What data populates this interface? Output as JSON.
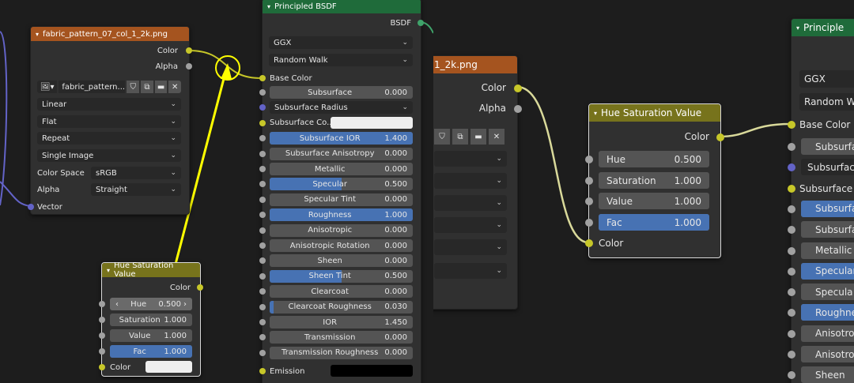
{
  "colors": {
    "wire_yellow": "#c7c729",
    "annotation": "#ffff00",
    "orange_header": "#a5541f",
    "green_header": "#1f6b3a",
    "olive_header": "#77731c",
    "field_fill": "#4772b3"
  },
  "left": {
    "image_node": {
      "title": "fabric_pattern_07_col_1_2k.png",
      "outputs": [
        "Color",
        "Alpha"
      ],
      "image_name": "fabric_pattern...",
      "interpolation": "Linear",
      "projection": "Flat",
      "extension": "Repeat",
      "source": "Single Image",
      "color_space_label": "Color Space",
      "color_space": "sRGB",
      "alpha_label": "Alpha",
      "alpha_mode": "Straight",
      "vector_label": "Vector"
    },
    "hsv_node": {
      "title": "Hue Saturation Value",
      "output": "Color",
      "fields": [
        {
          "label": "Hue",
          "value": "0.500"
        },
        {
          "label": "Saturation",
          "value": "1.000"
        },
        {
          "label": "Value",
          "value": "1.000"
        },
        {
          "label": "Fac",
          "value": "1.000",
          "fill": 1.0
        }
      ],
      "color_label": "Color"
    },
    "bsdf_node": {
      "title": "Principled BSDF",
      "output": "BSDF",
      "distribution": "GGX",
      "subsurface_method": "Random Walk",
      "base_color_label": "Base Color",
      "rows": [
        {
          "label": "Subsurface",
          "value": "0.000",
          "fill": 0
        },
        {
          "label": "Subsurface Radius",
          "value": "",
          "type": "drop"
        },
        {
          "label": "Subsurface Co...",
          "value": "",
          "type": "color"
        },
        {
          "label": "Subsurface IOR",
          "value": "1.400",
          "fill": 1.0
        },
        {
          "label": "Subsurface Anisotropy",
          "value": "0.000",
          "fill": 0
        },
        {
          "label": "Metallic",
          "value": "0.000",
          "fill": 0
        },
        {
          "label": "Specular",
          "value": "0.500",
          "fill": 0.5
        },
        {
          "label": "Specular Tint",
          "value": "0.000",
          "fill": 0
        },
        {
          "label": "Roughness",
          "value": "1.000",
          "fill": 1.0
        },
        {
          "label": "Anisotropic",
          "value": "0.000",
          "fill": 0
        },
        {
          "label": "Anisotropic Rotation",
          "value": "0.000",
          "fill": 0
        },
        {
          "label": "Sheen",
          "value": "0.000",
          "fill": 0
        },
        {
          "label": "Sheen Tint",
          "value": "0.500",
          "fill": 0.5
        },
        {
          "label": "Clearcoat",
          "value": "0.000",
          "fill": 0
        },
        {
          "label": "Clearcoat Roughness",
          "value": "0.030",
          "fill": 0.03
        },
        {
          "label": "IOR",
          "value": "1.450",
          "fill": 0
        },
        {
          "label": "Transmission",
          "value": "0.000",
          "fill": 0
        },
        {
          "label": "Transmission Roughness",
          "value": "0.000",
          "fill": 0
        }
      ],
      "emission_label": "Emission"
    }
  },
  "right": {
    "image_node": {
      "title": "1_2k.png",
      "outputs": [
        "Color",
        "Alpha"
      ]
    },
    "hsv_node": {
      "title": "Hue Saturation Value",
      "output": "Color",
      "fields": [
        {
          "label": "Hue",
          "value": "0.500"
        },
        {
          "label": "Saturation",
          "value": "1.000"
        },
        {
          "label": "Value",
          "value": "1.000"
        },
        {
          "label": "Fac",
          "value": "1.000",
          "fill": 1.0
        }
      ],
      "color_label": "Color"
    },
    "bsdf_node": {
      "title": "Principle",
      "distribution": "GGX",
      "subsurface_method": "Random W",
      "base_color_label": "Base Color",
      "rows": [
        "Subsurfa",
        "Subsurfac",
        "Subsurface",
        "Subsurfa",
        "Subsurfa",
        "Metallic",
        "Specular",
        "Specula",
        "Roughne",
        "Anisotro",
        "Anisotro",
        "Sheen"
      ]
    }
  }
}
